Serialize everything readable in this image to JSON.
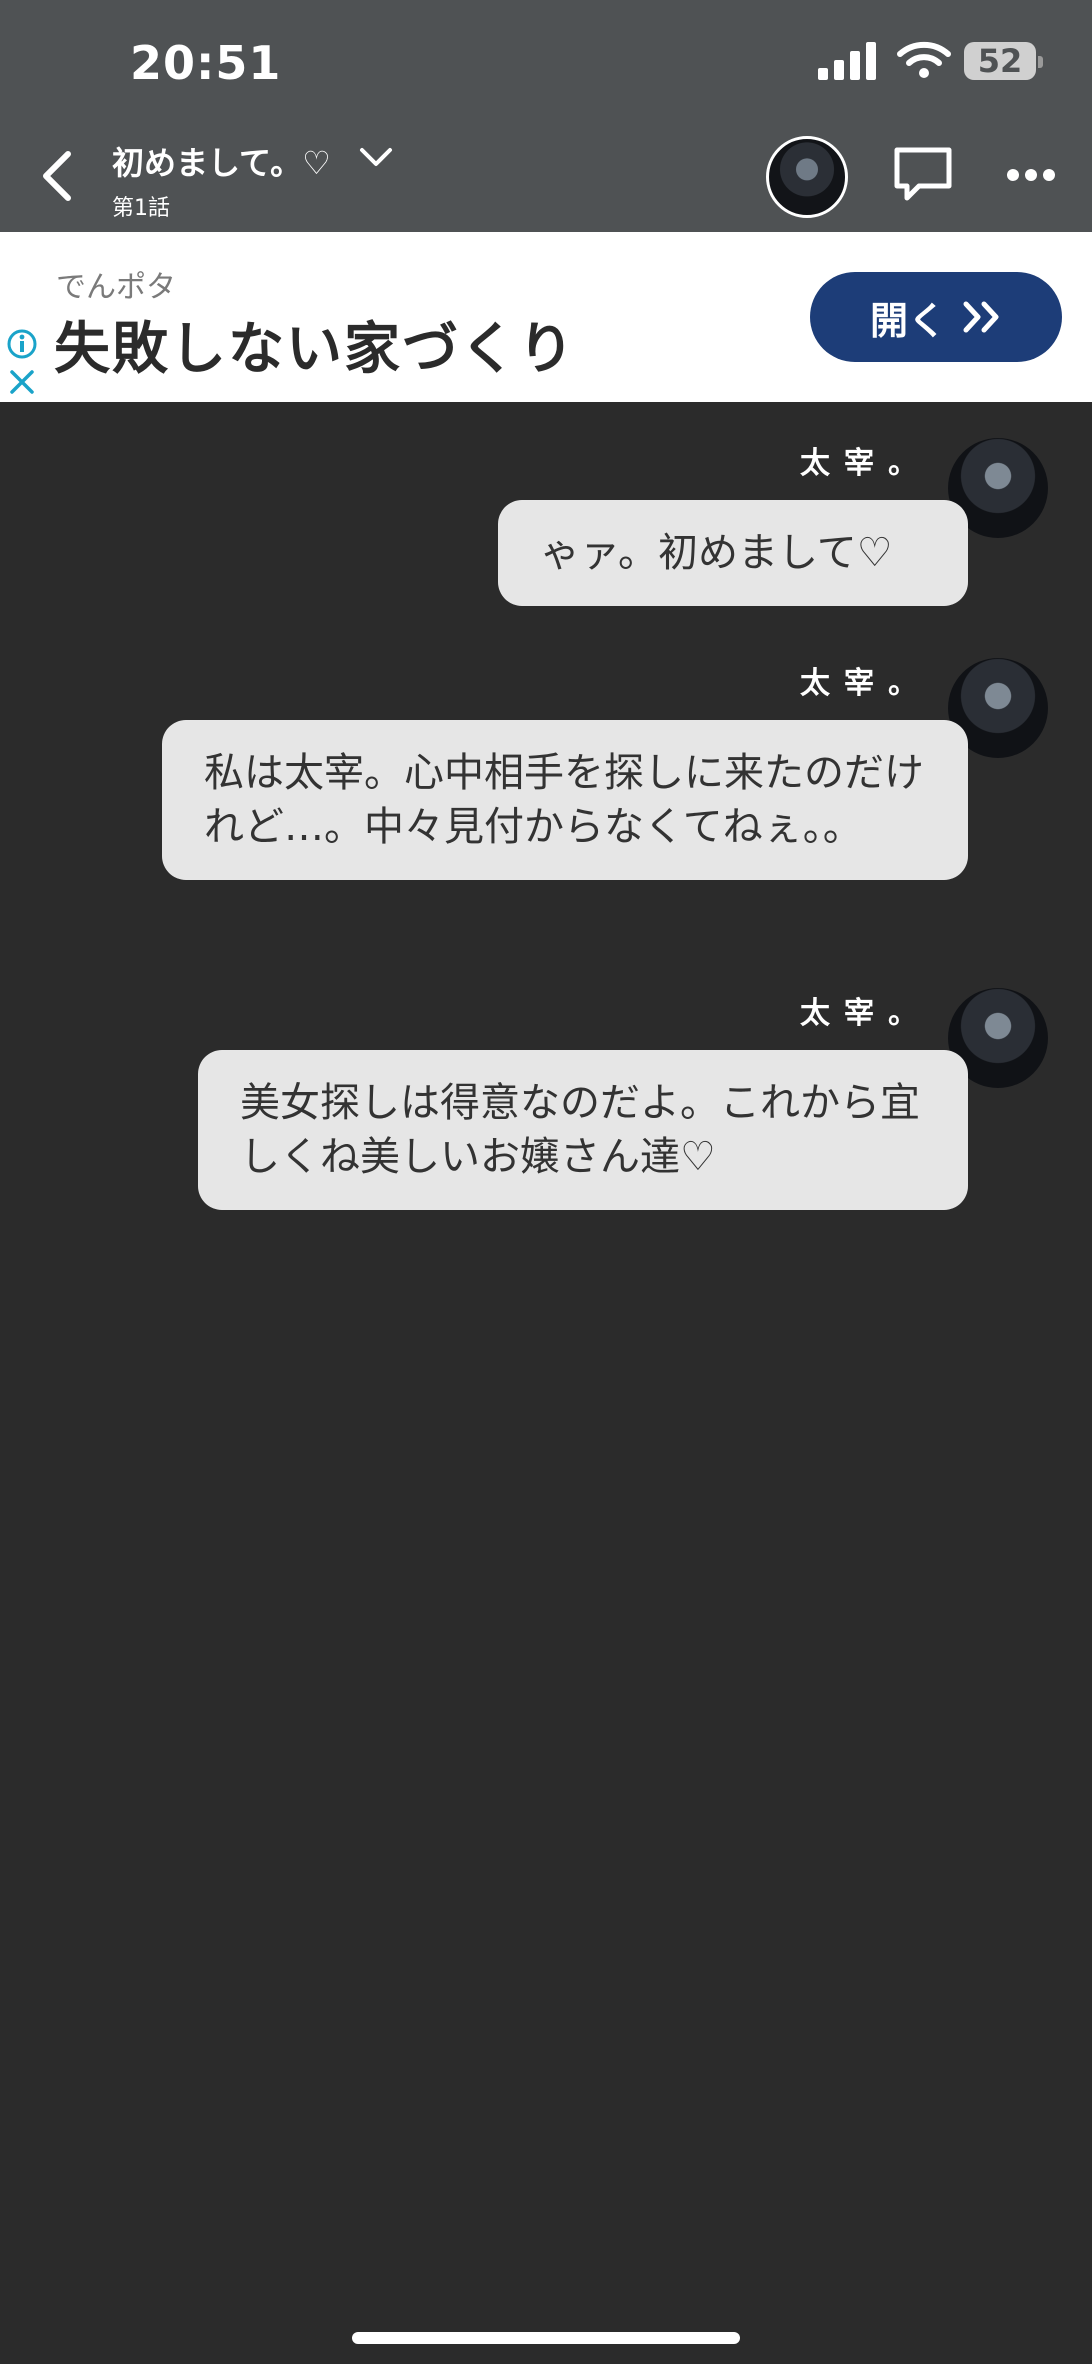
{
  "status_bar": {
    "time": "20:51",
    "battery": "52",
    "icons": [
      "signal-icon",
      "wifi-icon",
      "battery-icon"
    ]
  },
  "nav": {
    "title": "初めまして。♡",
    "subtitle": "第1話",
    "icons": [
      "back-chevron-icon",
      "chevron-down-icon",
      "avatar",
      "comment-icon",
      "more-icon"
    ]
  },
  "ad": {
    "sponsor": "でんポタ",
    "headline": "失敗しない家づくり",
    "button_label": "開く",
    "accent": "#1d3d78",
    "info_color": "#1aa3c9"
  },
  "messages": [
    {
      "sender": "太宰。",
      "text": "ゃァ。初めまして♡"
    },
    {
      "sender": "太宰。",
      "text": "私は太宰。心中相手を探しに来たのだけれど…。中々見付からなくてねぇ。。"
    },
    {
      "sender": "太宰。",
      "text": "美女探しは得意なのだよ。これから宜しくね美しいお嬢さん達♡"
    }
  ],
  "colors": {
    "background": "#2b2b2b",
    "topbar": "#4f5254",
    "bubble": "#e6e6e6",
    "bubble_text": "#333333"
  }
}
